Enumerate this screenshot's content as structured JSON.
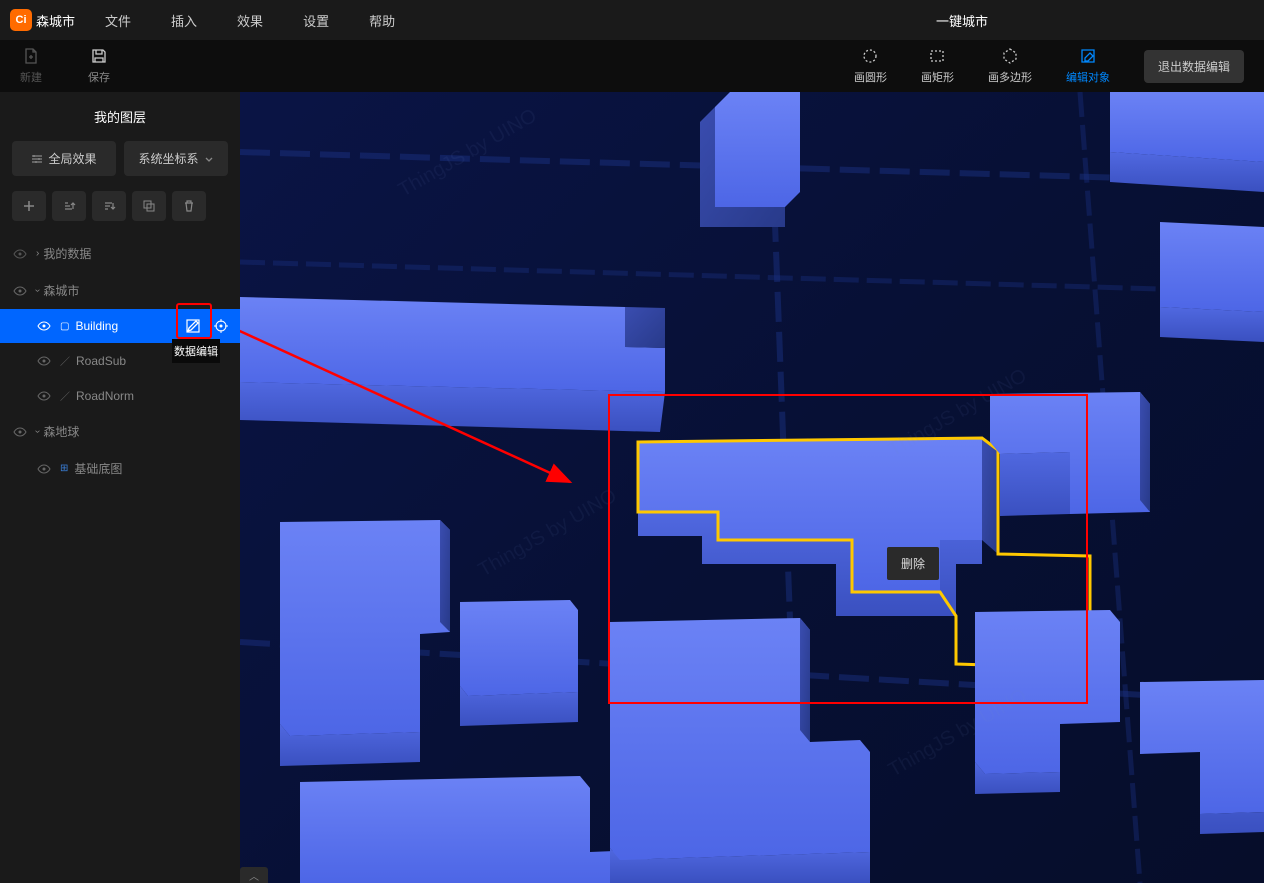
{
  "app": {
    "logo_text": "Ci",
    "name": "森城市"
  },
  "menu": [
    "文件",
    "插入",
    "效果",
    "设置",
    "帮助"
  ],
  "document_title": "一键城市",
  "toolbar_left": [
    {
      "label": "新建",
      "icon": "new",
      "enabled": false
    },
    {
      "label": "保存",
      "icon": "save",
      "enabled": true
    }
  ],
  "toolbar_right": [
    {
      "label": "画圆形",
      "icon": "circle",
      "active": false
    },
    {
      "label": "画矩形",
      "icon": "rect",
      "active": false
    },
    {
      "label": "画多边形",
      "icon": "polygon",
      "active": false
    },
    {
      "label": "编辑对象",
      "icon": "edit",
      "active": true
    }
  ],
  "exit_button": "退出数据编辑",
  "sidebar": {
    "title": "我的图层",
    "filters": {
      "global_effect": "全局效果",
      "coord_system": "系统坐标系"
    },
    "icons": [
      "add",
      "sort-asc",
      "sort-desc",
      "copy",
      "delete"
    ],
    "tree": [
      {
        "label": "我的数据",
        "level": 1,
        "type": "group",
        "expanded": false,
        "visible": true,
        "selected": false
      },
      {
        "label": "森城市",
        "level": 1,
        "type": "group",
        "expanded": true,
        "visible": true,
        "selected": false
      },
      {
        "label": "Building",
        "level": 2,
        "type": "polygon",
        "visible": true,
        "selected": true,
        "actions": [
          "edit",
          "target"
        ]
      },
      {
        "label": "RoadSub",
        "level": 2,
        "type": "line",
        "visible": true,
        "selected": false
      },
      {
        "label": "RoadNorm",
        "level": 2,
        "type": "line",
        "visible": true,
        "selected": false
      },
      {
        "label": "森地球",
        "level": 1,
        "type": "group",
        "expanded": true,
        "visible": true,
        "selected": false
      },
      {
        "label": "基础底图",
        "level": 2,
        "type": "basemap",
        "visible": true,
        "selected": false
      }
    ],
    "edit_tooltip": "数据编辑"
  },
  "context_menu": {
    "label": "删除"
  },
  "watermark_text": "ThingJS by UINO",
  "colors": {
    "accent": "#0066ff",
    "highlight": "#ff0000",
    "selection_outline": "#ffc800",
    "building_fill": "#4d66e6",
    "building_side": "#3a4db0",
    "bg_dark": "#071035"
  }
}
